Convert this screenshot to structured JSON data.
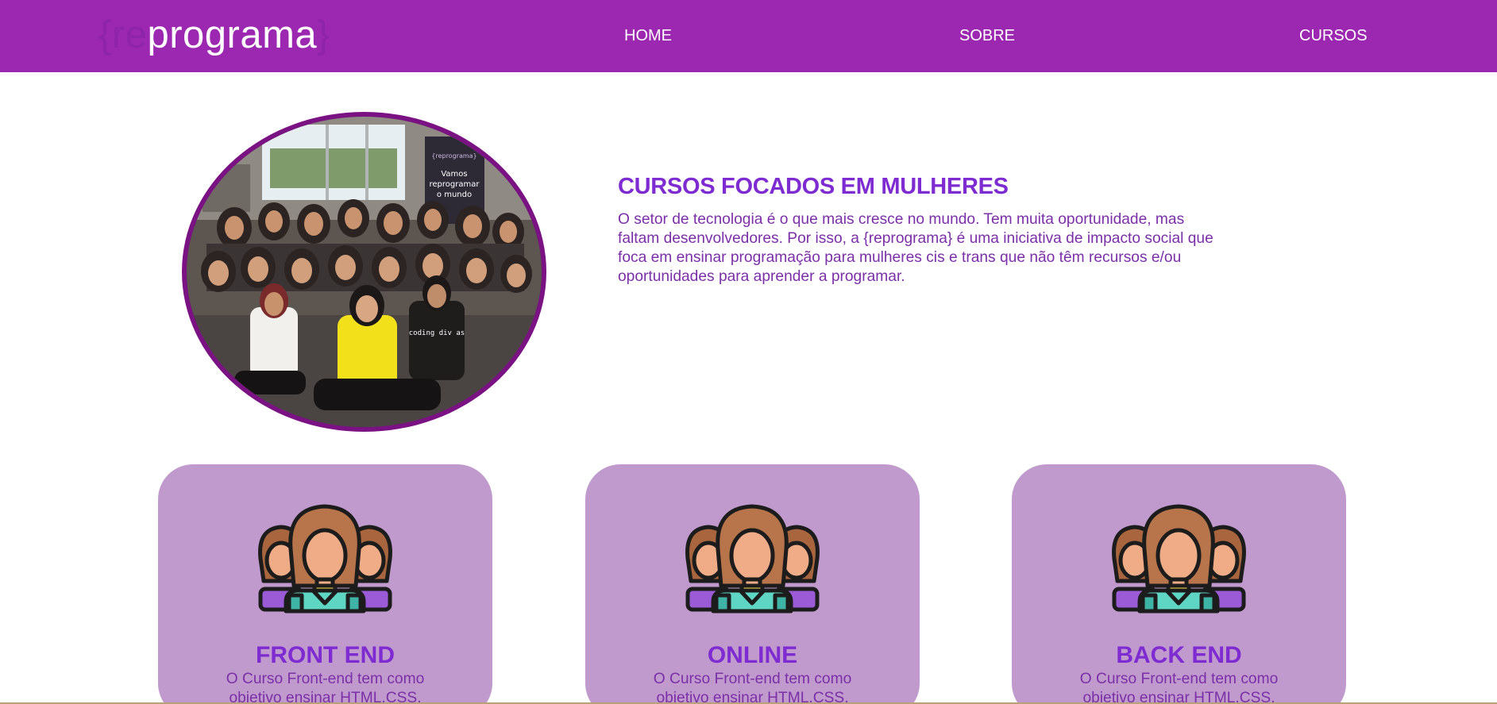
{
  "header": {
    "logo": {
      "brace_open": "{",
      "prefix": "re",
      "word": "programa",
      "brace_close": "}"
    },
    "nav": [
      {
        "label": "HOME"
      },
      {
        "label": "SOBRE"
      },
      {
        "label": "CURSOS"
      }
    ]
  },
  "hero": {
    "image_icon": "group-photo",
    "banner_text": [
      "{reprograma}",
      "Vamos",
      "reprogramar",
      "o mundo"
    ],
    "shirt_text": "coding div as",
    "title": "CURSOS FOCADOS EM MULHERES",
    "text": "O setor de tecnologia é o que mais cresce no mundo. Tem muita oportunidade, mas faltam desenvolvedores. Por isso, a {reprograma} é uma iniciativa de impacto social que foca em ensinar programação para mulheres cis e trans que não têm recursos e/ou oportunidades para aprender a programar."
  },
  "cards": [
    {
      "icon": "women-group-icon",
      "title": "FRONT END",
      "text": "O Curso Front-end tem como objetivo ensinar HTML,CSS,"
    },
    {
      "icon": "women-group-icon",
      "title": "ONLINE",
      "text": "O Curso Front-end tem como objetivo ensinar HTML,CSS,"
    },
    {
      "icon": "women-group-icon",
      "title": "BACK END",
      "text": "O Curso Front-end tem como objetivo ensinar HTML,CSS,"
    }
  ],
  "colors": {
    "header_bg": "#9c27b0",
    "accent_title": "#7e2bd1",
    "body_text": "#7b2fa8",
    "card_bg": "#c09acd",
    "photo_border": "#7b1283"
  }
}
